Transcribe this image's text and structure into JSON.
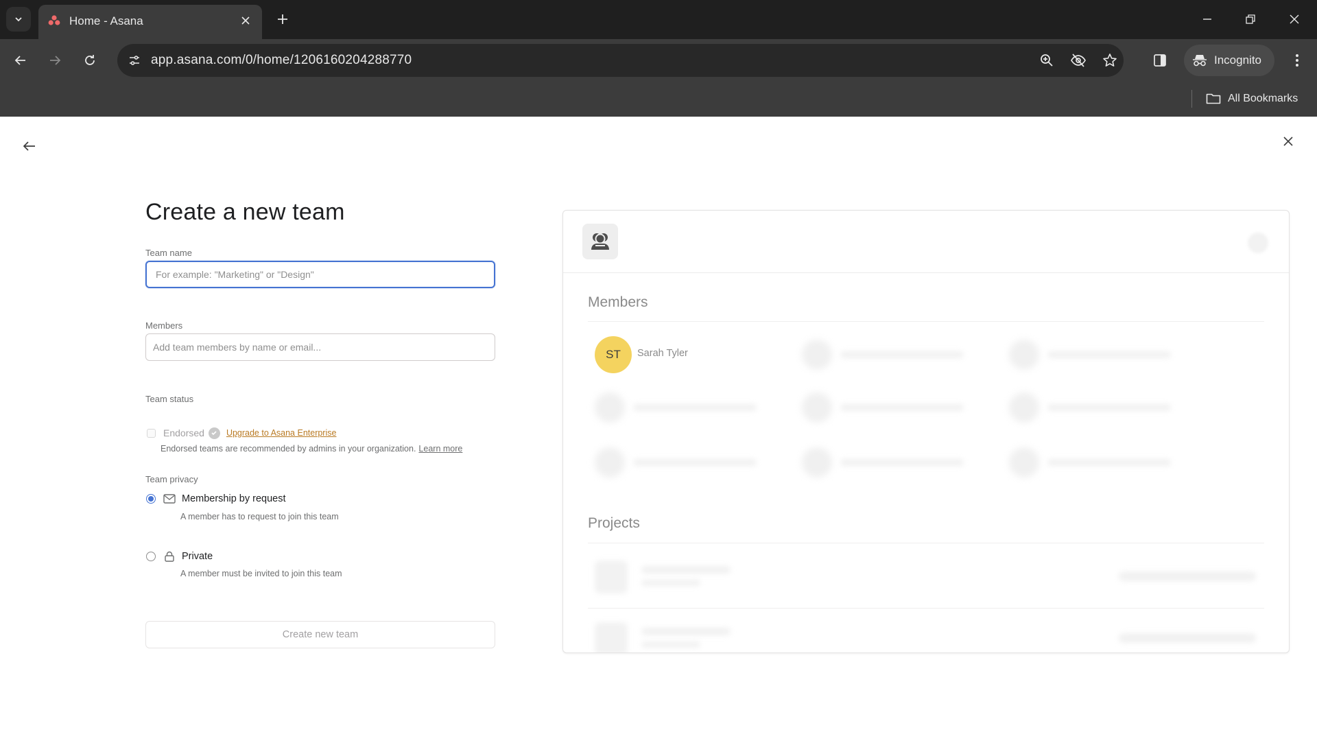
{
  "browser": {
    "tab_title": "Home - Asana",
    "url": "app.asana.com/0/home/1206160204288770",
    "incognito_label": "Incognito",
    "all_bookmarks_label": "All Bookmarks"
  },
  "form": {
    "title": "Create a new team",
    "team_name_label": "Team name",
    "team_name_placeholder": "For example: \"Marketing\" or \"Design\"",
    "members_label": "Members",
    "members_placeholder": "Add team members by name or email...",
    "team_status_label": "Team status",
    "endorsed_label": "Endorsed",
    "upgrade_link": "Upgrade to Asana Enterprise",
    "endorsed_help": "Endorsed teams are recommended by admins in your organization.",
    "learn_more": "Learn more",
    "team_privacy_label": "Team privacy",
    "privacy_options": [
      {
        "label": "Membership by request",
        "description": "A member has to request to join this team",
        "selected": true
      },
      {
        "label": "Private",
        "description": "A member must be invited to join this team",
        "selected": false
      }
    ],
    "create_button": "Create new team"
  },
  "preview": {
    "members_heading": "Members",
    "member_initials": "ST",
    "member_name": "Sarah Tyler",
    "projects_heading": "Projects"
  },
  "colors": {
    "accent": "#4573d2",
    "avatar": "#f4d35f",
    "link": "#b97a23"
  }
}
